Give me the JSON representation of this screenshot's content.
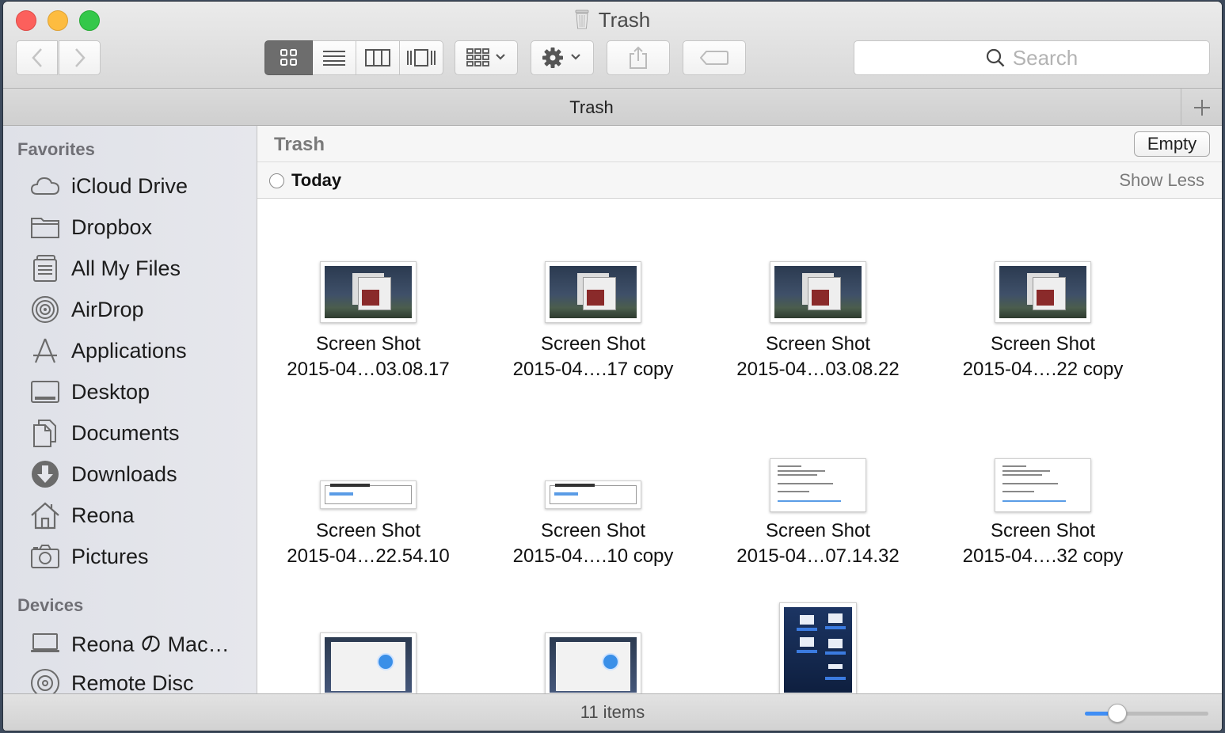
{
  "window": {
    "title": "Trash"
  },
  "toolbar": {
    "search_placeholder": "Search",
    "view_modes": [
      "icon-view",
      "list-view",
      "column-view",
      "cover-flow-view"
    ],
    "active_view": "icon-view"
  },
  "tab": {
    "label": "Trash"
  },
  "sidebar": {
    "favorites_header": "Favorites",
    "favorites": [
      {
        "label": "iCloud Drive",
        "icon": "cloud-icon"
      },
      {
        "label": "Dropbox",
        "icon": "folder-icon"
      },
      {
        "label": "All My Files",
        "icon": "all-files-icon"
      },
      {
        "label": "AirDrop",
        "icon": "airdrop-icon"
      },
      {
        "label": "Applications",
        "icon": "applications-icon"
      },
      {
        "label": "Desktop",
        "icon": "desktop-icon"
      },
      {
        "label": "Documents",
        "icon": "documents-icon"
      },
      {
        "label": "Downloads",
        "icon": "downloads-icon"
      },
      {
        "label": "Reona",
        "icon": "home-icon"
      },
      {
        "label": "Pictures",
        "icon": "camera-icon"
      }
    ],
    "devices_header": "Devices",
    "devices": [
      {
        "label": "Reona の Mac…",
        "icon": "laptop-icon"
      },
      {
        "label": "Remote Disc",
        "icon": "disc-icon"
      }
    ]
  },
  "content": {
    "path_title": "Trash",
    "empty_label": "Empty",
    "group_title": "Today",
    "show_less_label": "Show Less",
    "files": [
      {
        "line1": "Screen Shot",
        "line2": "2015-04…03.08.17",
        "thumb": "desktop"
      },
      {
        "line1": "Screen Shot",
        "line2": "2015-04….17 copy",
        "thumb": "desktop"
      },
      {
        "line1": "Screen Shot",
        "line2": "2015-04…03.08.22",
        "thumb": "desktop"
      },
      {
        "line1": "Screen Shot",
        "line2": "2015-04….22 copy",
        "thumb": "desktop"
      },
      {
        "line1": "Screen Shot",
        "line2": "2015-04…22.54.10",
        "thumb": "wide"
      },
      {
        "line1": "Screen Shot",
        "line2": "2015-04….10 copy",
        "thumb": "wide"
      },
      {
        "line1": "Screen Shot",
        "line2": "2015-04…07.14.32",
        "thumb": "mail"
      },
      {
        "line1": "Screen Shot",
        "line2": "2015-04….32 copy",
        "thumb": "mail"
      },
      {
        "line1": "",
        "line2": "",
        "thumb": "safari"
      },
      {
        "line1": "",
        "line2": "",
        "thumb": "safari"
      },
      {
        "line1": "",
        "line2": "",
        "thumb": "blue"
      }
    ]
  },
  "status": {
    "item_count": "11 items",
    "icon_size_level": 0.26
  },
  "colors": {
    "accent": "#3f8ef5",
    "close": "#fc605c",
    "minimize": "#fdbc40",
    "zoom": "#34c84a"
  }
}
